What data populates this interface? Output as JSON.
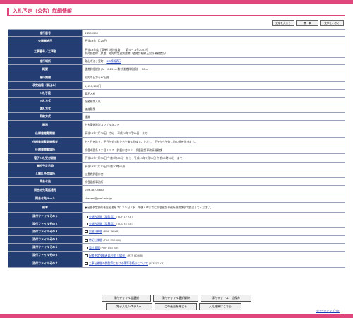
{
  "header": {
    "title": "入札予定（公告）詳細情報"
  },
  "font_size": {
    "increase": "文字を大きく",
    "standard": "標　準",
    "decrease": "文字を小さく"
  },
  "rows": [
    {
      "label": "施行番号",
      "value": "41500292"
    },
    {
      "label": "公開開始日",
      "value": "平成19年7月20日"
    },
    {
      "label": "工事番号／工事名",
      "value": "平成19年度［県単］地特道路　　第４－１号2003号\n東町野登線［県道］地方特定道路整備（道路詳細修正設計業務委託）"
    },
    {
      "label": "施行場所",
      "value": "亀山市江ヶ室町",
      "link": "GIS情報表示"
    },
    {
      "label": "概要",
      "value": "道路詳細設計(A)　0.22km数付道路詳細設計　70m"
    },
    {
      "label": "施行期間",
      "value": "契約の日から60日間"
    },
    {
      "label": "予定価格（税込み）",
      "value": "1,430,100円"
    },
    {
      "label": "入札手段",
      "value": "電子入札"
    },
    {
      "label": "入札方式",
      "value": "指名競争入札"
    },
    {
      "label": "落札方式",
      "value": "価格競争"
    },
    {
      "label": "契約方式",
      "value": "通常"
    },
    {
      "label": "種別",
      "value": "土木関係建設コンサルタント"
    },
    {
      "label": "仕様書閲覧期間",
      "value": "平成19年7月20日　から　平成19年7月30日　まで"
    },
    {
      "label": "仕様書閲覧期間備考",
      "value": "土・日を除く、平日午前９時から午後４時まで。ただし、正午から午後１時の間を除きます。"
    },
    {
      "label": "仕様書閲覧場所",
      "value": "鈴鹿市西条５丁目１１７　鈴鹿庁舎３Ｆ　鈴鹿建設事務所総務課"
    },
    {
      "label": "電子入札受付期間",
      "value": "平成19年7月30日 午前9時00分　から　平成19年7月31日 午前10時30分　まで"
    },
    {
      "label": "開札予定日時",
      "value": "平成19年7月31日 午前10時40分"
    },
    {
      "label": "入開札予定場所",
      "value": "三重県鈴鹿庁舎"
    },
    {
      "label": "問合せ先",
      "value": "鈴鹿建設事務所"
    },
    {
      "label": "問合せ先電話番号",
      "value": "059-382-8680"
    },
    {
      "label": "問合せ先メール",
      "value": "skensei@pref.mie.jp"
    },
    {
      "label": "備考",
      "value": "●配書予定技術者届出書を７月２５日（水）午後４時までに鈴鹿建設事務所総務課まで提出してください。"
    },
    {
      "label": "添付ファイルその１",
      "file": "金額内訳書（閲覧用）",
      "meta": "(PDF 17 KB)"
    },
    {
      "label": "添付ファイルその２",
      "file": "金額内訳書（見積用）",
      "meta": "(XLS 35 KB)"
    },
    {
      "label": "添付ファイルその３",
      "file": "設量計算書",
      "meta": "(PDF 36 KB)"
    },
    {
      "label": "添付ファイルその４",
      "file": "特記仕様書",
      "meta": "(PDF 353 KB)"
    },
    {
      "label": "添付ファイルその５",
      "file": "添付図面",
      "meta": "(PDF 158 KB)"
    },
    {
      "label": "添付ファイルその６",
      "file": "配書予定技術者届出書（設計）",
      "meta": "(RTF 60 KB)"
    },
    {
      "label": "添付ファイルその７",
      "file": "工事仕様書の閲覧等における簿等手続きについて",
      "meta": "(RTF 57 KB)"
    }
  ],
  "actions": {
    "select_all": "添付ファイル全選択",
    "deselect_all": "添付ファイル選択解除",
    "save_all": "添付ファイル一括保存",
    "e_bid": "電子入札システムへ",
    "close": "この画面を閉じる",
    "results": "入札結果はこちら"
  },
  "page_top": "<ページトップへ>"
}
